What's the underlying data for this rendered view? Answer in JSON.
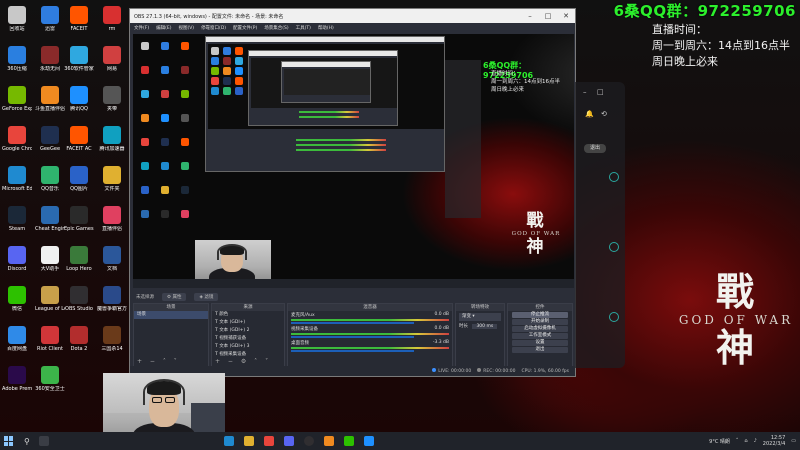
{
  "overlay": {
    "qq": "6桑QQ群：972259706",
    "schedule_title": "直播时间：",
    "schedule_line1": "周一到周六：14点到16点半",
    "schedule_line2": "周日晚上必来"
  },
  "wallpaper": {
    "logo_cjk_top": "戰",
    "logo_en": "GOD OF WAR",
    "logo_cjk_bottom": "神"
  },
  "desktop_icons": [
    {
      "label": "回收站",
      "color": "#c8c8c8"
    },
    {
      "label": "迅雷",
      "color": "#2f7de0"
    },
    {
      "label": "FACEIT",
      "color": "#ff5500"
    },
    {
      "label": "rm",
      "color": "#d83030"
    },
    {
      "label": "360压缩",
      "color": "#2a7fe0"
    },
    {
      "label": "永劫无间",
      "color": "#8a2a2a"
    },
    {
      "label": "360软件管家",
      "color": "#2fa8e0"
    },
    {
      "label": "网易",
      "color": "#d04040"
    },
    {
      "label": "GeForce Experience",
      "color": "#76b900"
    },
    {
      "label": "斗鱼直播伴侣",
      "color": "#f08a20"
    },
    {
      "label": "腾讯QQ",
      "color": "#1e90ff"
    },
    {
      "label": "夹带",
      "color": "#555555"
    },
    {
      "label": "Google Chrome",
      "color": "#e8453c"
    },
    {
      "label": "GeeGee",
      "color": "#1f2f4f"
    },
    {
      "label": "FACEIT AC",
      "color": "#ff5500"
    },
    {
      "label": "腾讯加速器",
      "color": "#10a0c0"
    },
    {
      "label": "Microsoft Edge",
      "color": "#1f8ad0"
    },
    {
      "label": "QQ音乐",
      "color": "#2fb46e"
    },
    {
      "label": "QQ图片",
      "color": "#2a62c8"
    },
    {
      "label": "文件夹",
      "color": "#e0b030"
    },
    {
      "label": "Steam",
      "color": "#1b2838"
    },
    {
      "label": "Cheat Engine",
      "color": "#2a6ab0"
    },
    {
      "label": "Epic Games Launcher",
      "color": "#2a2a2a"
    },
    {
      "label": "直播伴侣",
      "color": "#e04060"
    },
    {
      "label": "Discord",
      "color": "#5865f2"
    },
    {
      "label": "大V助手",
      "color": "#f0f0f0"
    },
    {
      "label": "Loop Hero",
      "color": "#3a7a3a"
    },
    {
      "label": "文档",
      "color": "#2b579a"
    },
    {
      "label": "微信",
      "color": "#2dc100"
    },
    {
      "label": "League of Legends",
      "color": "#c8a04a"
    },
    {
      "label": "OBS Studio",
      "color": "#302e31"
    },
    {
      "label": "魔兽争霸官方对战平台",
      "color": "#2a4a8a"
    },
    {
      "label": "百度网盘",
      "color": "#2f8ae8"
    },
    {
      "label": "Riot Client",
      "color": "#d13639"
    },
    {
      "label": "Dota 2",
      "color": "#b22d2d"
    },
    {
      "label": "三国杀14",
      "color": "#6a3a1a"
    },
    {
      "label": "Adobe Premie",
      "color": "#2a0a4a"
    },
    {
      "label": "360安全卫士",
      "color": "#3cb44a"
    }
  ],
  "obs": {
    "title": "OBS 27.1.3 (64-bit, windows) - 配置文件: 未命名 - 场景: 未命名",
    "menu": [
      "文件(F)",
      "编辑(E)",
      "视图(V)",
      "停靠窗口(D)",
      "配置文件(P)",
      "场景集合(S)",
      "工具(T)",
      "帮助(H)"
    ],
    "scene_bar": {
      "label": "未选择源",
      "properties": "属性",
      "filters": "滤镜"
    },
    "docks": {
      "scenes_title": "场景",
      "scenes": [
        "场景"
      ],
      "sources_title": "来源",
      "sources": [
        "颜色",
        "文本 (GDI+)",
        "文本 (GDI+) 2",
        "视频捕获设备",
        "文本 (GDI+) 3",
        "视频采集设备"
      ],
      "mixer_title": "混音器",
      "mixer_tracks": [
        {
          "name": "麦克风/Aux",
          "db": "0.0 dB"
        },
        {
          "name": "视频采集设备",
          "db": "0.0 dB"
        },
        {
          "name": "桌面音频",
          "db": "-3.3 dB"
        }
      ],
      "transitions_title": "转场特效",
      "transition_value": "渐变",
      "duration_label": "时长",
      "duration_value": "300 ms",
      "controls_title": "控件",
      "controls": [
        "停止推流",
        "开始录制",
        "启动虚拟摄像机",
        "工作室模式",
        "设置",
        "退出"
      ]
    },
    "status": {
      "live": "LIVE: 00:00:00",
      "rec": "REC: 00:00:00",
      "cpu": "CPU: 1.9%, 60.00 fps"
    }
  },
  "side_panel": {
    "exit_label": "退出"
  },
  "taskbar": {
    "weather": "9°C 晴朗",
    "time": "12:57",
    "date": "2022/3/4"
  },
  "colors": {
    "accent_green": "#2cf02c",
    "obs_bg": "#2b2e38",
    "wallpaper_red": "#7a0c0c"
  }
}
